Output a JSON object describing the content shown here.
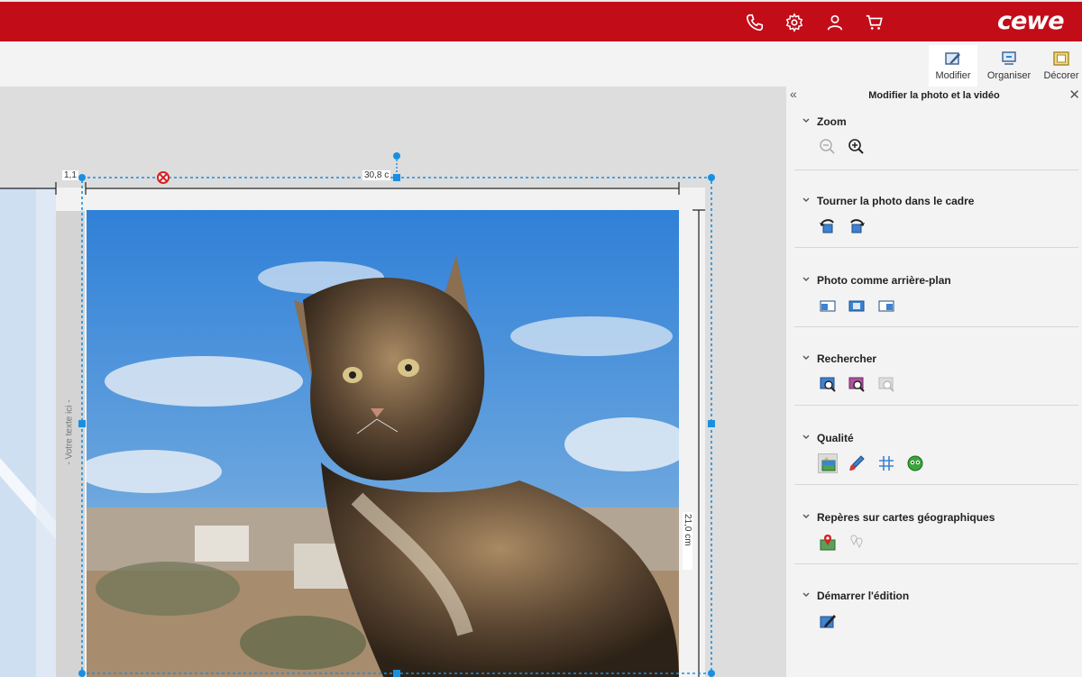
{
  "header": {
    "logo_text": "cewe",
    "brand_color": "#c20d19",
    "icons": [
      "phone-icon",
      "gear-icon",
      "user-icon",
      "cart-icon"
    ]
  },
  "toolbar": {
    "tabs": [
      {
        "label": "Modifier",
        "icon": "edit-photo-icon",
        "active": true
      },
      {
        "label": "Organiser",
        "icon": "arrange-icon",
        "active": false
      },
      {
        "label": "Décorer",
        "icon": "frame-icon",
        "active": false
      }
    ]
  },
  "canvas": {
    "ruler_left": "1,1",
    "ruler_width": "30,8 c",
    "ruler_height": "21,0 cm",
    "placeholder_text": "- Votre texte ici -",
    "selection_color": "#1a8fe0"
  },
  "panel": {
    "title": "Modifier la photo et la vidéo",
    "sections": [
      {
        "title": "Zoom",
        "icons": [
          "zoom-out-icon",
          "zoom-in-icon"
        ]
      },
      {
        "title": "Tourner la photo dans le cadre",
        "icons": [
          "rotate-left-icon",
          "rotate-right-icon"
        ]
      },
      {
        "title": "Photo comme arrière-plan",
        "icons": [
          "background-left-icon",
          "background-center-icon",
          "background-right-icon"
        ]
      },
      {
        "title": "Rechercher",
        "icons": [
          "search-photo-icon",
          "search-similar-icon",
          "search-disabled-icon"
        ]
      },
      {
        "title": "Qualité",
        "icons": [
          "auto-enhance-icon",
          "brush-icon",
          "grid-icon",
          "red-eye-icon"
        ]
      },
      {
        "title": "Repères sur cartes géographiques",
        "icons": [
          "map-pin-icon",
          "map-pin-disabled-icon"
        ]
      },
      {
        "title": "Démarrer l'édition",
        "icons": [
          "edit-start-icon"
        ]
      }
    ]
  }
}
